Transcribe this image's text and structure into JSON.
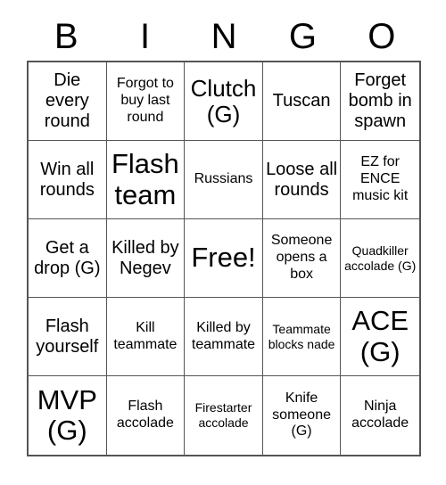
{
  "header": {
    "letters": [
      "B",
      "I",
      "N",
      "G",
      "O"
    ]
  },
  "grid": {
    "rows": 5,
    "columns": 5,
    "border_color": "#555555",
    "background_color": "#ffffff",
    "text_color": "#000000",
    "cells": [
      {
        "text": "Die every round",
        "size": "md"
      },
      {
        "text": "Forgot to buy last round",
        "size": "sm"
      },
      {
        "text": "Clutch (G)",
        "size": "lg"
      },
      {
        "text": "Tuscan",
        "size": "md"
      },
      {
        "text": "Forget bomb in spawn",
        "size": "md"
      },
      {
        "text": "Win all rounds",
        "size": "md"
      },
      {
        "text": "Flash team",
        "size": "xl"
      },
      {
        "text": "Russians",
        "size": "sm"
      },
      {
        "text": "Loose all rounds",
        "size": "md"
      },
      {
        "text": "EZ for ENCE music kit",
        "size": "sm"
      },
      {
        "text": "Get a drop (G)",
        "size": "md"
      },
      {
        "text": "Killed by Negev",
        "size": "md"
      },
      {
        "text": "Free!",
        "size": "xl"
      },
      {
        "text": "Someone opens a box",
        "size": "sm"
      },
      {
        "text": "Quadkiller accolade (G)",
        "size": "xs"
      },
      {
        "text": "Flash yourself",
        "size": "md"
      },
      {
        "text": "Kill teammate",
        "size": "sm"
      },
      {
        "text": "Killed by teammate",
        "size": "sm"
      },
      {
        "text": "Teammate blocks nade",
        "size": "xs"
      },
      {
        "text": "ACE (G)",
        "size": "xl"
      },
      {
        "text": "MVP (G)",
        "size": "xl"
      },
      {
        "text": "Flash accolade",
        "size": "sm"
      },
      {
        "text": "Firestarter accolade",
        "size": "xs"
      },
      {
        "text": "Knife someone (G)",
        "size": "sm"
      },
      {
        "text": "Ninja accolade",
        "size": "sm"
      }
    ]
  }
}
